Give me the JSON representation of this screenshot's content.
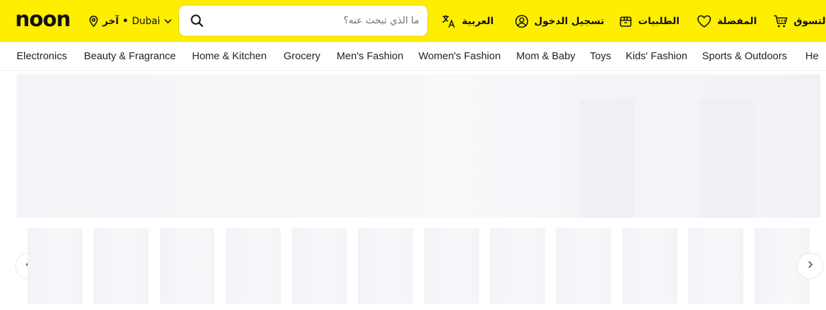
{
  "header": {
    "logo": "noon",
    "location": {
      "prefix": "آخر",
      "separator": "•",
      "city": "Dubai"
    },
    "search": {
      "placeholder": "ما الذي تبحث عنه؟",
      "value": ""
    },
    "actions": [
      {
        "label": "التسوق",
        "icon": "cart-icon"
      },
      {
        "label": "المفضلة",
        "icon": "heart-icon"
      },
      {
        "label": "الطلبيات",
        "icon": "orders-box-icon"
      },
      {
        "label": "تسجيل الدخول",
        "icon": "user-icon"
      },
      {
        "label": "العربية",
        "icon": "translate-icon"
      }
    ],
    "colors": {
      "brand_yellow": "#feee00",
      "text": "#111111"
    }
  },
  "categories": [
    "Electronics",
    "Beauty & Fragrance",
    "Home & Kitchen",
    "Grocery",
    "Men's Fashion",
    "Women's Fashion",
    "Mom & Baby",
    "Toys",
    "Kids' Fashion",
    "Sports & Outdoors",
    "He"
  ],
  "carousel": {
    "prev_icon": "chevron-left-icon",
    "next_icon": "chevron-right-icon",
    "tile_count": 12
  }
}
